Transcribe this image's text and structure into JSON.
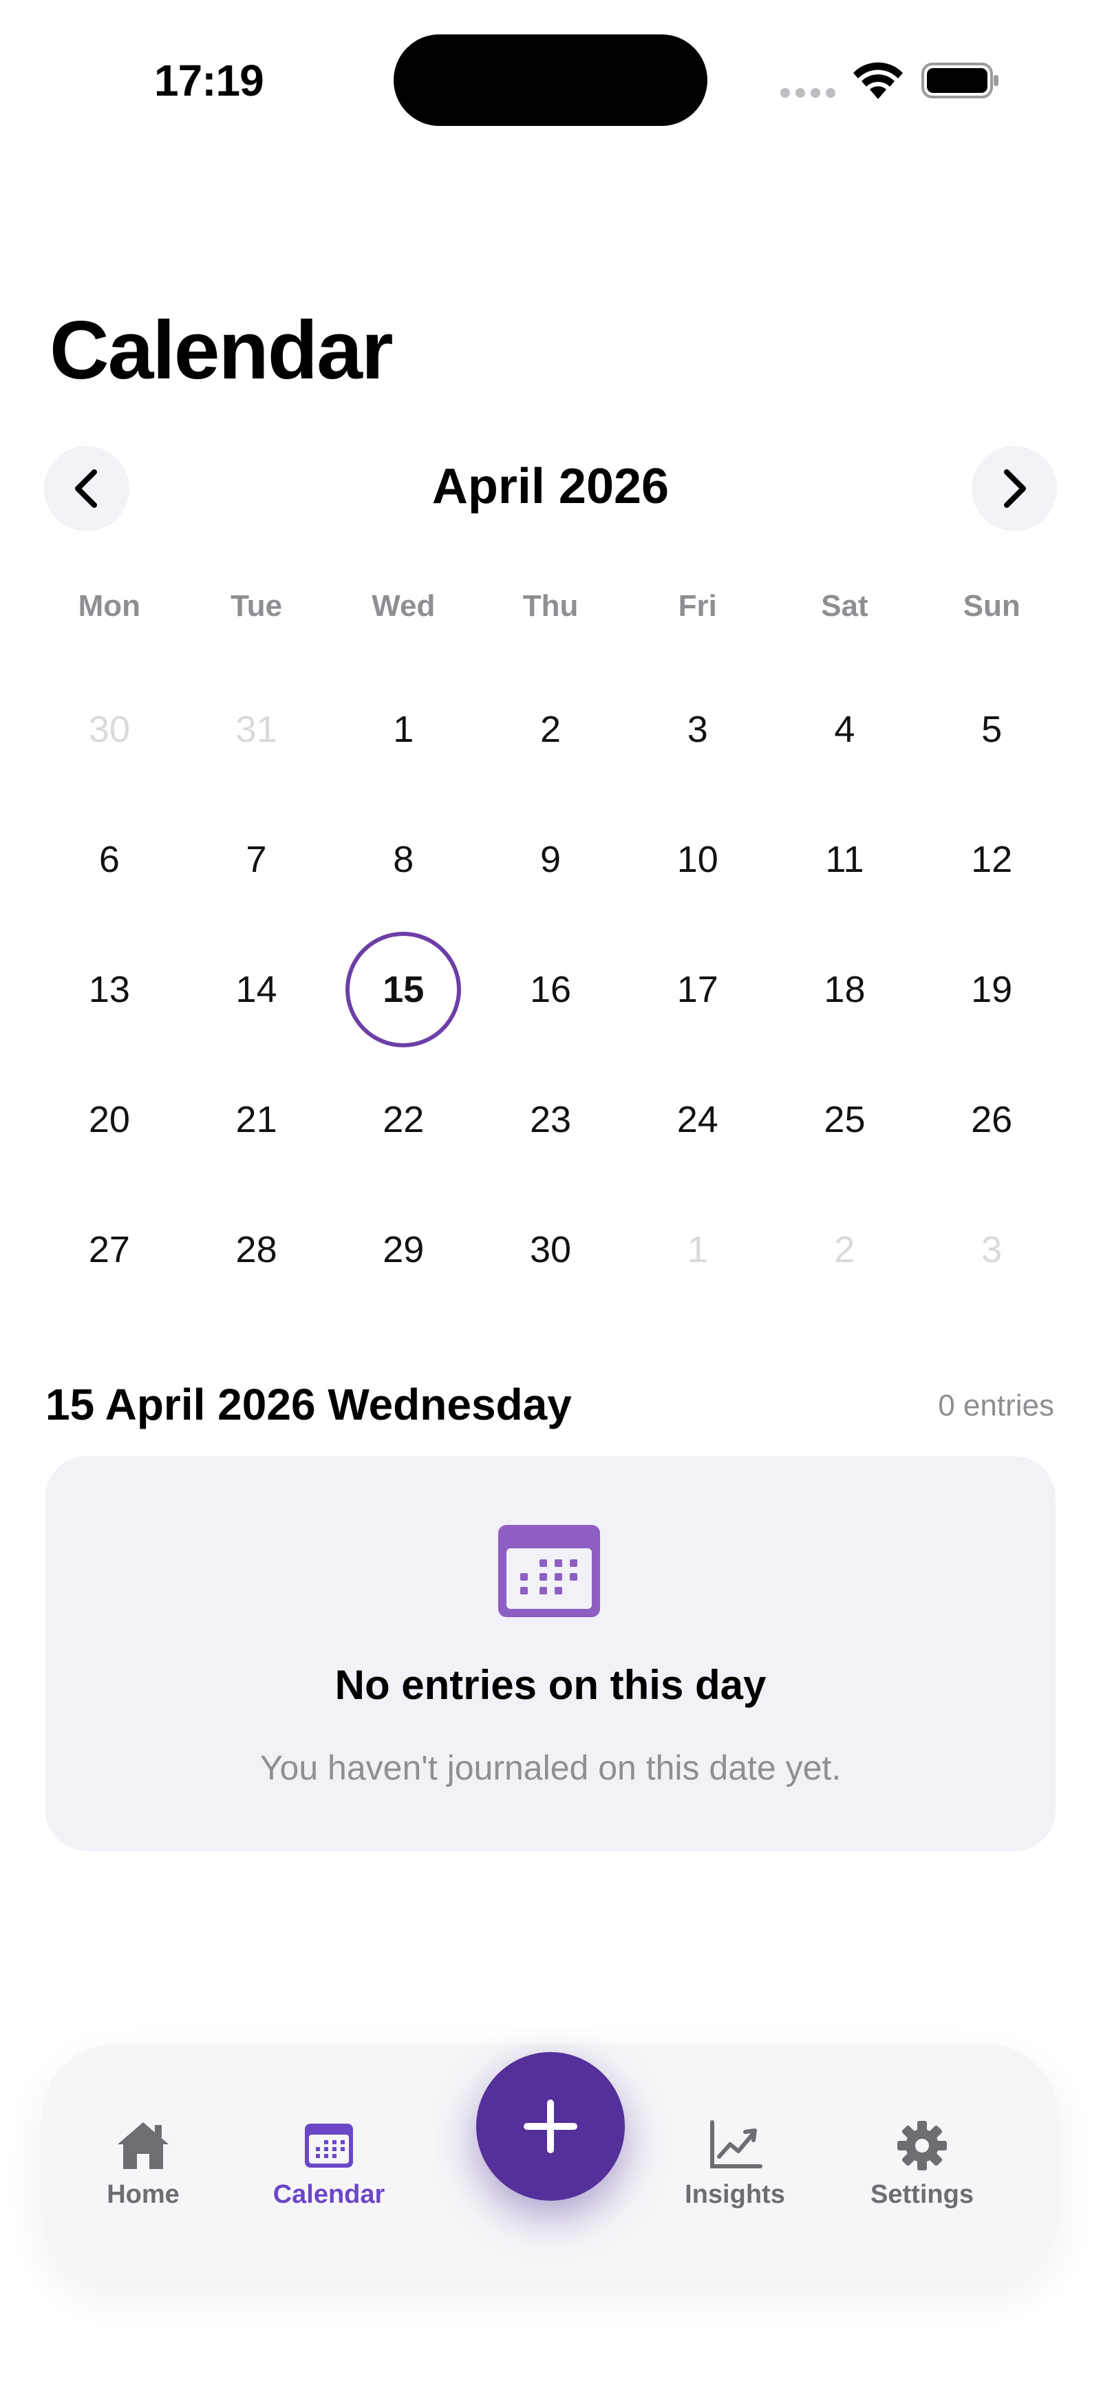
{
  "status_bar": {
    "time": "17:19"
  },
  "page": {
    "title": "Calendar"
  },
  "calendar": {
    "month_label": "April 2026",
    "weekdays": [
      "Mon",
      "Tue",
      "Wed",
      "Thu",
      "Fri",
      "Sat",
      "Sun"
    ],
    "weeks": [
      [
        "30",
        "31",
        "1",
        "2",
        "3",
        "4",
        "5"
      ],
      [
        "6",
        "7",
        "8",
        "9",
        "10",
        "11",
        "12"
      ],
      [
        "13",
        "14",
        "15",
        "16",
        "17",
        "18",
        "19"
      ],
      [
        "20",
        "21",
        "22",
        "23",
        "24",
        "25",
        "26"
      ],
      [
        "27",
        "28",
        "29",
        "30",
        "1",
        "2",
        "3"
      ]
    ],
    "selected_day": "15"
  },
  "selection": {
    "heading": "15 April 2026 Wednesday",
    "count": "0 entries"
  },
  "empty_state": {
    "icon": "calendar-icon",
    "title": "No entries on this day",
    "subtitle": "You haven't journaled on this date yet."
  },
  "tab_bar": {
    "home": "Home",
    "calendar": "Calendar",
    "insights": "Insights",
    "settings": "Settings",
    "active": "Calendar"
  },
  "colors": {
    "accent": "#6b47c7",
    "fab": "#54309a",
    "selected_ring": "#6b3fa6",
    "calendar_icon": "#8e5fc2"
  }
}
